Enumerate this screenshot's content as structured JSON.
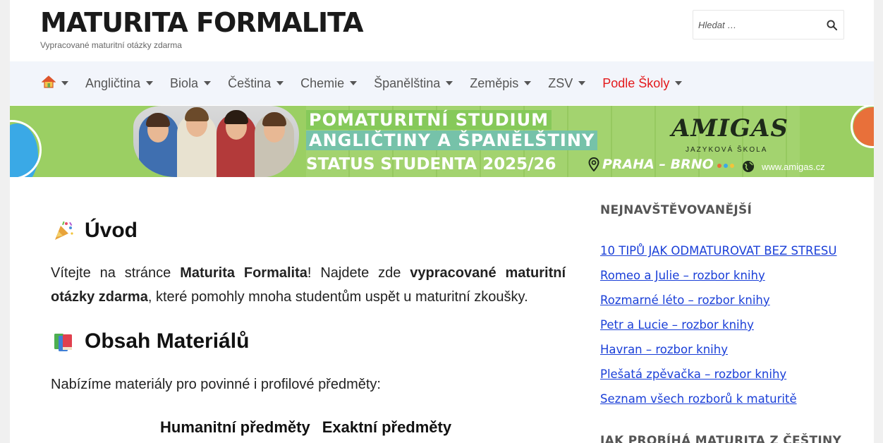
{
  "header": {
    "site_title": "MATURITA FORMALITA",
    "site_description": "Vypracované maturitní otázky zdarma",
    "search_placeholder": "Hledat …"
  },
  "nav": {
    "items": [
      {
        "label": "",
        "icon": "home-icon"
      },
      {
        "label": "Angličtina"
      },
      {
        "label": "Biola"
      },
      {
        "label": "Čeština"
      },
      {
        "label": "Chemie"
      },
      {
        "label": "Španělština"
      },
      {
        "label": "Zeměpis"
      },
      {
        "label": "ZSV"
      },
      {
        "label": "Podle Školy",
        "color": "#e3191b"
      }
    ]
  },
  "banner": {
    "line1": "POMATURITNÍ STUDIUM",
    "line2": "ANGLIČTINY A ŠPANĚLŠTINY",
    "line3": "STATUS STUDENTA 2025/26",
    "brand": "AMIGAS",
    "brand_sub": "JAZYKOVÁ ŠKOLA",
    "cities": "PRAHA – BRNO",
    "website": "www.amigas.cz",
    "bg_color": "#9bcf63"
  },
  "main": {
    "intro": {
      "heading": "Úvod",
      "p_start": "Vítejte na stránce ",
      "p_bold1": "Maturita Formalita",
      "p_mid": "! Najdete zde ",
      "p_bold2": "vypracované maturitní otázky zdarma",
      "p_end": ", které pomohly mnoha studentům uspět u maturitní zkoušky."
    },
    "materials": {
      "heading": "Obsah Materiálů",
      "text": "Nabízíme materiály pro povinné i profilové předměty:",
      "columns": [
        "Humanitní předměty",
        "Exaktní předměty"
      ]
    }
  },
  "sidebar": {
    "popular_title": "NEJNAVŠTĚVOVANĚJŠÍ",
    "popular_links": [
      "10 TIPŮ JAK ODMATUROVAT BEZ STRESU",
      "Romeo a Julie – rozbor knihy",
      "Rozmarné léto – rozbor knihy",
      "Petr a Lucie – rozbor knihy",
      "Havran – rozbor knihy",
      "Plešatá zpěvačka – rozbor knihy",
      "Seznam všech rozborů k maturitě"
    ],
    "second_title": "JAK PROBÍHÁ MATURITA Z ČEŠTINY",
    "link_color": "#1a3fd8"
  }
}
